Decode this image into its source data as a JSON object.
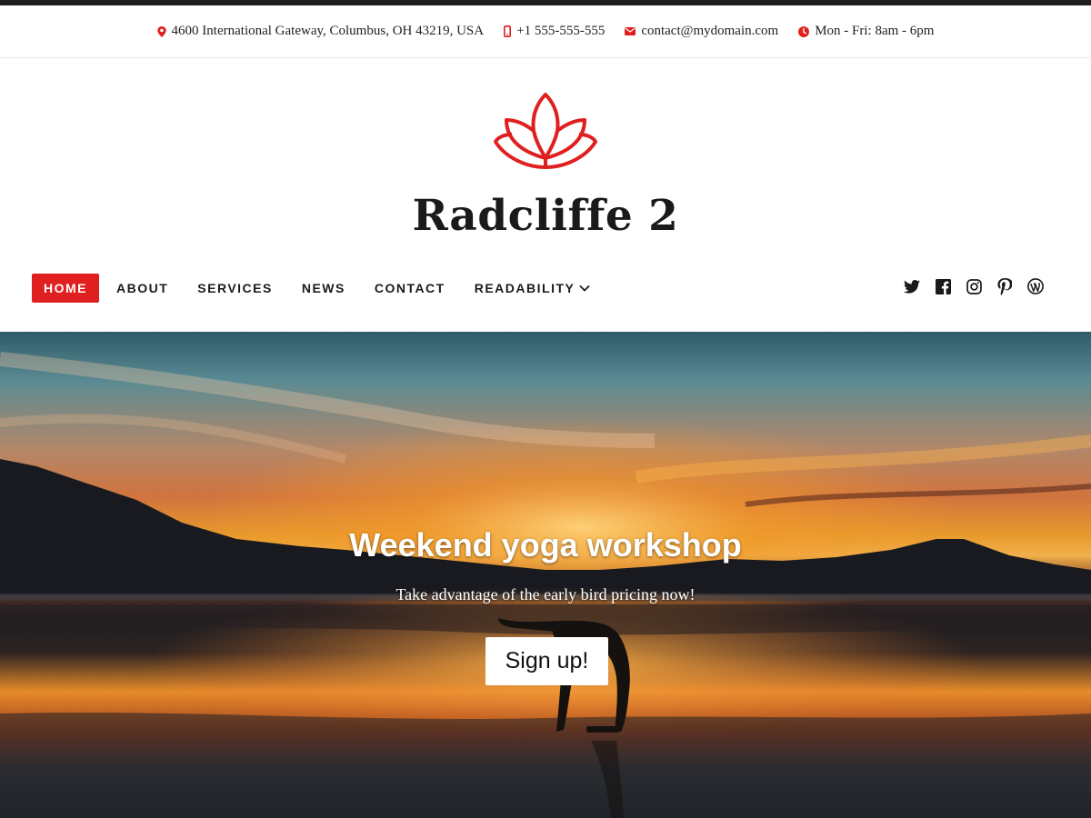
{
  "topbar": {
    "address": "4600 International Gateway, Columbus, OH 43219, USA",
    "phone": "+1 555-555-555",
    "email": "contact@mydomain.com",
    "hours": "Mon - Fri: 8am - 6pm"
  },
  "site": {
    "title": "Radcliffe 2",
    "logo_icon": "lotus-logo",
    "accent_color": "#e02020"
  },
  "nav": {
    "items": [
      {
        "label": "HOME",
        "active": true
      },
      {
        "label": "ABOUT"
      },
      {
        "label": "SERVICES"
      },
      {
        "label": "NEWS"
      },
      {
        "label": "CONTACT"
      },
      {
        "label": "READABILITY",
        "has_dropdown": true
      }
    ]
  },
  "social": [
    "twitter-icon",
    "facebook-icon",
    "instagram-icon",
    "pinterest-icon",
    "wordpress-icon"
  ],
  "hero": {
    "title": "Weekend yoga workshop",
    "subtitle": "Take advantage of the early bird pricing now!",
    "button_label": "Sign up!"
  }
}
